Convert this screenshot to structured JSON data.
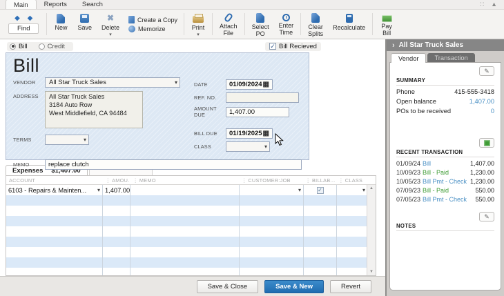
{
  "window": {
    "menu_tabs": [
      "Main",
      "Reports",
      "Search"
    ]
  },
  "toolbar": {
    "find": "Find",
    "new": "New",
    "save": "Save",
    "delete": "Delete",
    "create_copy": "Create a Copy",
    "memorize": "Memorize",
    "print": "Print",
    "attach_file": "Attach\nFile",
    "select_po": "Select\nPO",
    "enter_time": "Enter\nTime",
    "clear_splits": "Clear\nSplits",
    "recalculate": "Recalculate",
    "pay_bill": "Pay\nBill"
  },
  "bill_type": {
    "bill": "Bill",
    "credit": "Credit",
    "bill_received": "Bill Recieved"
  },
  "form": {
    "title": "Bill",
    "vendor_label": "VENDOR",
    "vendor": "All Star Truck Sales",
    "address_label": "ADDRESS",
    "address_lines": [
      "All Star Truck Sales",
      "3184 Auto Row",
      "West Middlefield, CA 94484"
    ],
    "terms_label": "TERMS",
    "terms": "",
    "memo_label": "MEMO",
    "memo": "replace clutch",
    "date_label": "DATE",
    "date": "01/09/2024",
    "ref_label": "REF. NO.",
    "ref": "",
    "amount_label": "AMOUNT DUE",
    "amount": "1,407.00",
    "bill_due_label": "BILL DUE",
    "bill_due": "01/19/2025",
    "class_label": "CLASS",
    "class": ""
  },
  "expenses": {
    "tab_label": "Expenses",
    "tab_amount": "$1,407.00",
    "columns": [
      "ACCOUNT",
      "AMOU...",
      "MEMO",
      "CUSTOMER:JOB",
      "BILLAB...",
      "CLASS"
    ],
    "rows": [
      {
        "account": "6103 - Repairs & Mainten...",
        "amount": "1,407.00",
        "memo": "",
        "customer_job": "",
        "billable": true,
        "class": ""
      }
    ],
    "empty_row_count": 8
  },
  "footer": {
    "save_close": "Save & Close",
    "save_new": "Save & New",
    "revert": "Revert"
  },
  "vendor_panel": {
    "title": "All Star Truck Sales",
    "tabs": [
      "Vendor",
      "Transaction"
    ],
    "summary": {
      "heading": "SUMMARY",
      "rows": [
        {
          "label": "Phone",
          "value": "415-555-3418",
          "kind": "plain"
        },
        {
          "label": "Open balance",
          "value": "1,407.00",
          "kind": "link"
        },
        {
          "label": "POs to be received",
          "value": "0",
          "kind": "link"
        }
      ]
    },
    "recent": {
      "heading": "RECENT TRANSACTION",
      "transactions": [
        {
          "date": "01/09/24",
          "type": "Bill",
          "kind": "link",
          "amount": "1,407.00"
        },
        {
          "date": "10/09/23",
          "type": "Bill - Paid",
          "kind": "paid",
          "amount": "1,230.00"
        },
        {
          "date": "10/05/23",
          "type": "Bill Pmt - Check",
          "kind": "link",
          "amount": "1,230.00"
        },
        {
          "date": "07/09/23",
          "type": "Bill - Paid",
          "kind": "paid",
          "amount": "550.00"
        },
        {
          "date": "07/05/23",
          "type": "Bill Pmt - Check",
          "kind": "link",
          "amount": "550.00"
        }
      ]
    },
    "notes_heading": "NOTES"
  },
  "icons": {
    "dropdown": "▾",
    "check": "✓",
    "calendar": "▦",
    "chevron": "›",
    "pencil": "✎",
    "diamonds": "◆ ◆",
    "expand": "∷",
    "collapse": "▲",
    "scroll_up": "▲",
    "scroll_down": "▼",
    "delete_x": "✖",
    "col_divider": "⋮"
  },
  "colors": {
    "accent_blue": "#2476bd",
    "link_blue": "#4a90c4",
    "paid_green": "#3f9c35",
    "form_bg": "#dde8f4",
    "row_alt": "#dbe9f8",
    "panel_header": "#868686"
  }
}
